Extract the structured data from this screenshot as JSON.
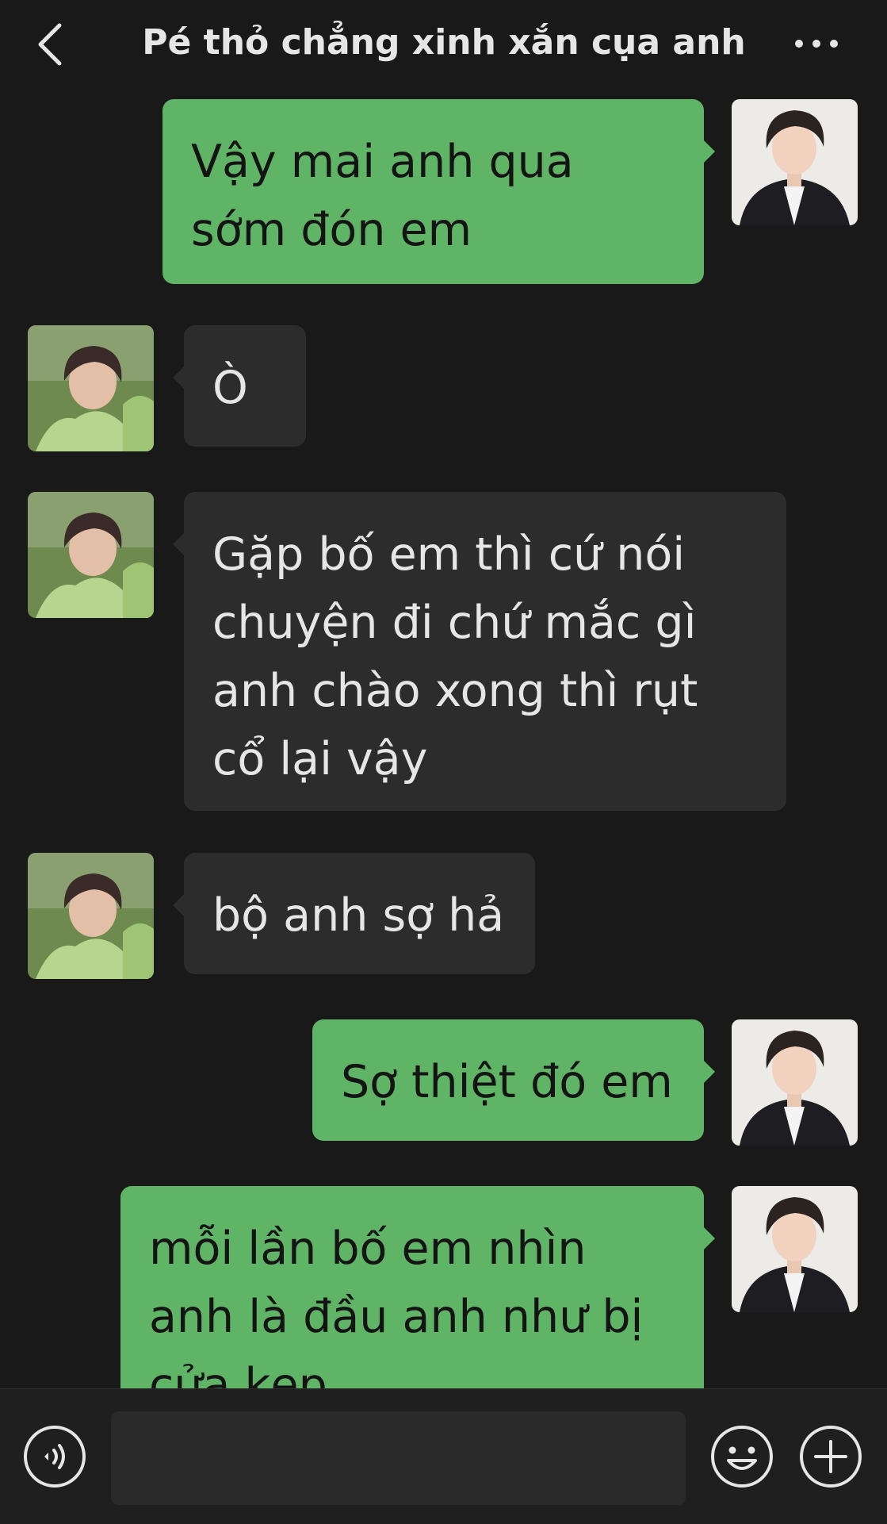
{
  "header": {
    "title": "Pé thỏ chẳng xinh xắn cụa anh",
    "back_icon": "chevron-left-icon",
    "more_icon": "more-horizontal-icon"
  },
  "messages": [
    {
      "side": "sent",
      "text": "Vậy mai anh qua sớm đón em"
    },
    {
      "side": "received",
      "text": "Ò"
    },
    {
      "side": "received",
      "text": "Gặp bố em thì cứ nói chuyện đi chứ mắc gì anh chào xong thì rụt cổ lại vậy"
    },
    {
      "side": "received",
      "text": "bộ anh sợ hả"
    },
    {
      "side": "sent",
      "text": "Sợ thiệt đó em"
    },
    {
      "side": "sent",
      "text": "mỗi lần bố em nhìn anh là đầu anh như bị cửa kẹp"
    }
  ],
  "input_bar": {
    "voice_icon": "voice-icon",
    "emoji_icon": "emoji-icon",
    "plus_icon": "plus-icon",
    "input_value": ""
  },
  "colors": {
    "background": "#191919",
    "sent_bubble": "#5fb466",
    "received_bubble": "#2c2c2c",
    "input_bar": "#1f1f1f"
  }
}
